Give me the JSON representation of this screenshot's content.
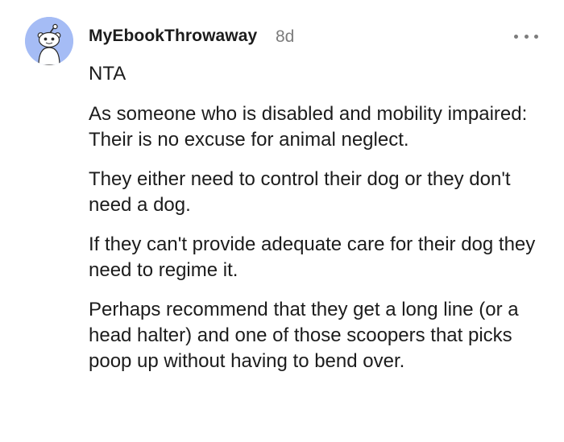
{
  "comment": {
    "author": "MyEbookThrowaway",
    "age": "8d",
    "avatar_icon": "reddit-snoo-avatar-icon",
    "avatar_color": "#a5bcf5",
    "more_icon": "more-options-icon",
    "paragraphs": [
      "NTA",
      "As someone who is disabled and mobility impaired: Their is no excuse for animal neglect.",
      "They either need to control their dog or they don't need a dog.",
      "If they can't provide adequate care for their dog they need to regime it.",
      "Perhaps recommend that they get a long line (or a head halter) and one of those scoopers that picks poop up without having to bend over."
    ]
  }
}
